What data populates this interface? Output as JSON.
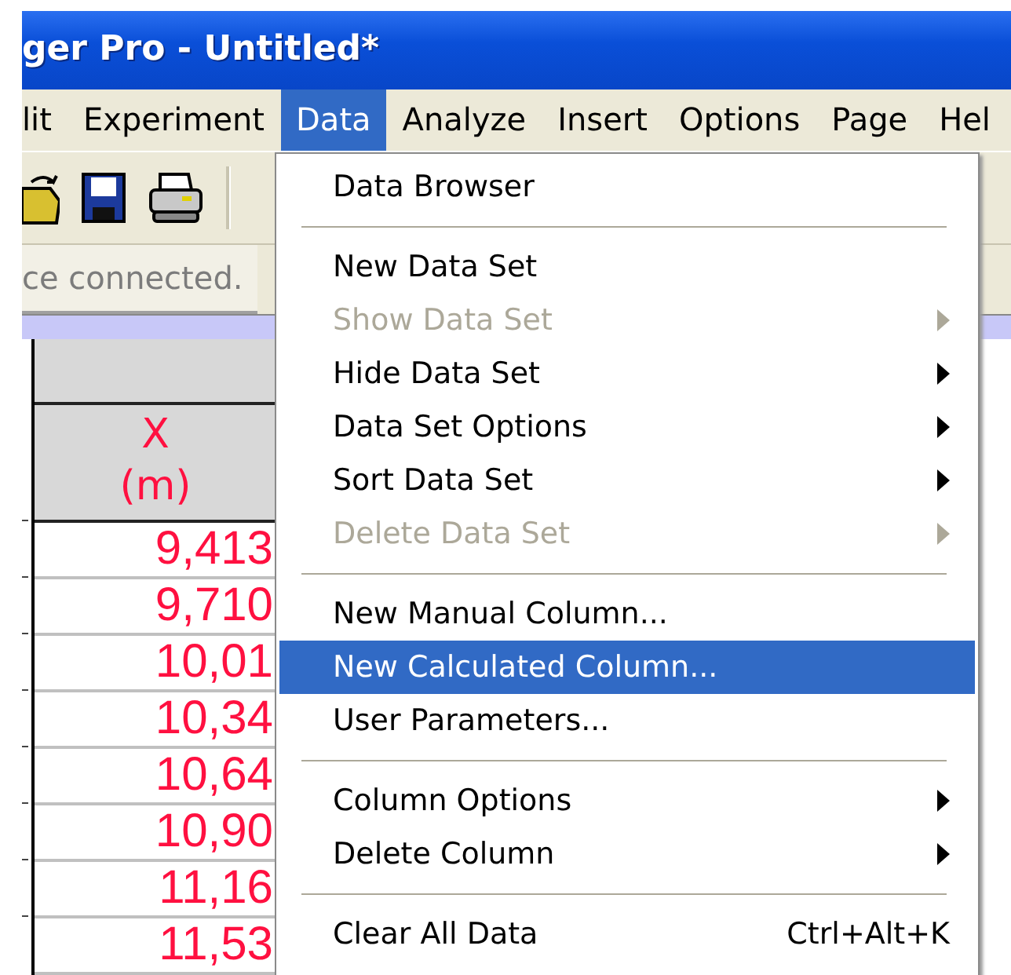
{
  "window": {
    "title": "ger Pro - Untitled*"
  },
  "menubar": [
    {
      "label": "lit",
      "selected": false
    },
    {
      "label": "Experiment",
      "selected": false
    },
    {
      "label": "Data",
      "selected": true
    },
    {
      "label": "Analyze",
      "selected": false
    },
    {
      "label": "Insert",
      "selected": false
    },
    {
      "label": "Options",
      "selected": false
    },
    {
      "label": "Page",
      "selected": false
    },
    {
      "label": "Hel",
      "selected": false
    }
  ],
  "status": "ce connected.",
  "table": {
    "column": {
      "name": "X",
      "unit": "(m)"
    },
    "rows": [
      "9,413",
      "9,710",
      "10,01",
      "10,34",
      "10,64",
      "10,90",
      "11,16",
      "11,53"
    ]
  },
  "menu": [
    {
      "kind": "item",
      "label": "Data Browser",
      "disabled": false,
      "submenu": false,
      "selected": false
    },
    {
      "kind": "separator"
    },
    {
      "kind": "item",
      "label": "New Data Set",
      "disabled": false,
      "submenu": false,
      "selected": false
    },
    {
      "kind": "item",
      "label": "Show Data Set",
      "disabled": true,
      "submenu": true,
      "selected": false
    },
    {
      "kind": "item",
      "label": "Hide Data Set",
      "disabled": false,
      "submenu": true,
      "selected": false
    },
    {
      "kind": "item",
      "label": "Data Set Options",
      "disabled": false,
      "submenu": true,
      "selected": false
    },
    {
      "kind": "item",
      "label": "Sort Data Set",
      "disabled": false,
      "submenu": true,
      "selected": false
    },
    {
      "kind": "item",
      "label": "Delete Data Set",
      "disabled": true,
      "submenu": true,
      "selected": false
    },
    {
      "kind": "separator"
    },
    {
      "kind": "item",
      "label": "New Manual Column...",
      "disabled": false,
      "submenu": false,
      "selected": false
    },
    {
      "kind": "item",
      "label": "New Calculated Column...",
      "disabled": false,
      "submenu": false,
      "selected": true
    },
    {
      "kind": "item",
      "label": "User Parameters...",
      "disabled": false,
      "submenu": false,
      "selected": false
    },
    {
      "kind": "separator"
    },
    {
      "kind": "item",
      "label": "Column Options",
      "disabled": false,
      "submenu": true,
      "selected": false
    },
    {
      "kind": "item",
      "label": "Delete Column",
      "disabled": false,
      "submenu": true,
      "selected": false
    },
    {
      "kind": "separator"
    },
    {
      "kind": "item",
      "label": "Clear All Data",
      "disabled": false,
      "submenu": false,
      "selected": false,
      "shortcut": "Ctrl+Alt+K"
    }
  ]
}
